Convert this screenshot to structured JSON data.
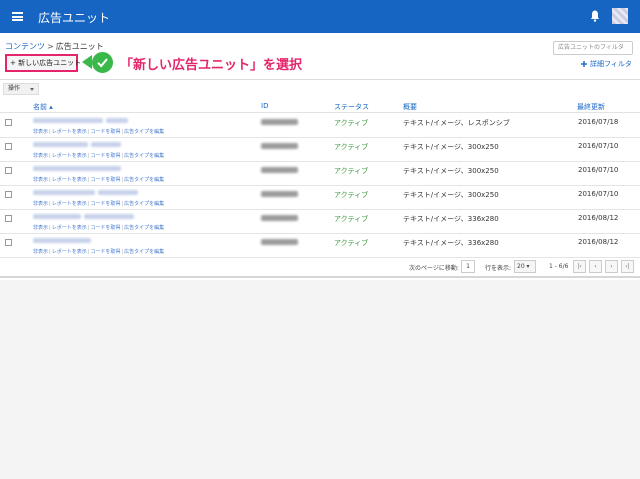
{
  "appbar": {
    "title": "広告ユニット",
    "color": "#1765c3"
  },
  "breadcrumb": {
    "parent": "コンテンツ",
    "separator": ">",
    "current": "広告ユニット"
  },
  "new_button": {
    "label": "+ 新しい広告ユニット"
  },
  "annotation": {
    "text": "「新しい広告ユニット」を選択",
    "accent": "#e5256b",
    "check_color": "#3bb84a"
  },
  "filter": {
    "placeholder": "広告ユニットのフィルタ",
    "advanced_label": "詳細フィルタ"
  },
  "actions": {
    "label": "操作"
  },
  "table": {
    "columns": {
      "name": "名前 ▴",
      "id": "ID",
      "status": "ステータス",
      "overview": "概要",
      "updated": "最終更新"
    },
    "link_labels": [
      "非表示",
      "レポートを表示",
      "コードを取得",
      "広告タイプを編集"
    ],
    "rows": [
      {
        "status": "アクティブ",
        "overview": "テキスト/イメージ、レスポンシブ",
        "updated": "2016/07/18"
      },
      {
        "status": "アクティブ",
        "overview": "テキスト/イメージ、300x250",
        "updated": "2016/07/10"
      },
      {
        "status": "アクティブ",
        "overview": "テキスト/イメージ、300x250",
        "updated": "2016/07/10"
      },
      {
        "status": "アクティブ",
        "overview": "テキスト/イメージ、300x250",
        "updated": "2016/07/10"
      },
      {
        "status": "アクティブ",
        "overview": "テキスト/イメージ、336x280",
        "updated": "2016/08/12"
      },
      {
        "status": "アクティブ",
        "overview": "テキスト/イメージ、336x280",
        "updated": "2016/08/12"
      }
    ]
  },
  "pagination": {
    "goto_label": "次のページに移動:",
    "page_value": "1",
    "rows_label": "行を表示:",
    "rows_value": "20 ▾",
    "range": "1 - 6/6",
    "first_icon": "first-page-icon",
    "prev_icon": "prev-page-icon",
    "next_icon": "next-page-icon",
    "last_icon": "last-page-icon"
  }
}
